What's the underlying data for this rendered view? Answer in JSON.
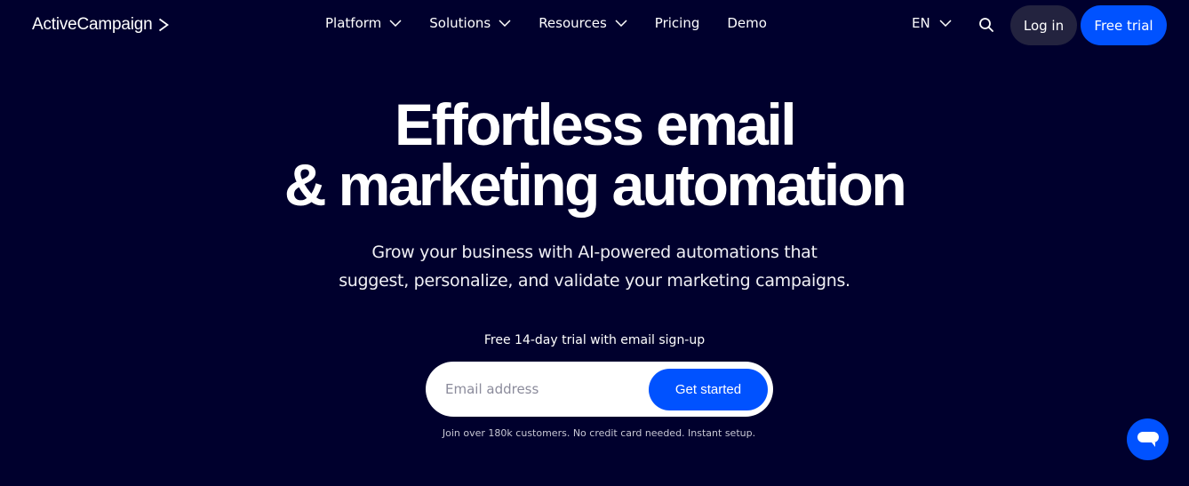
{
  "header": {
    "logo": {
      "text": "ActiveCampaign",
      "icon": "chevron-right-icon"
    },
    "nav": [
      {
        "label": "Platform",
        "has_dropdown": true
      },
      {
        "label": "Solutions",
        "has_dropdown": true
      },
      {
        "label": "Resources",
        "has_dropdown": true
      },
      {
        "label": "Pricing",
        "has_dropdown": false
      },
      {
        "label": "Demo",
        "has_dropdown": false
      }
    ],
    "language": {
      "label": "EN",
      "icon": "chevron-down-icon"
    },
    "search": {
      "icon": "search-icon"
    },
    "login_label": "Log in",
    "free_trial_label": "Free trial"
  },
  "hero": {
    "title_line1": "Effortless email",
    "title_line2": "& marketing automation",
    "subtitle_line1": "Grow your business with AI-powered automations that",
    "subtitle_line2": "suggest, personalize, and validate your marketing campaigns.",
    "trial_label": "Free 14-day trial with email sign-up",
    "email_placeholder": "Email address",
    "email_value": "",
    "cta_label": "Get started",
    "fineprint": "Join over 180k customers. No credit card needed. Instant setup."
  },
  "chat": {
    "icon": "chat-bubble-icon"
  },
  "colors": {
    "background": "#00002d",
    "accent": "#0052ff",
    "login_bg": "#23233f",
    "text": "#ffffff"
  }
}
